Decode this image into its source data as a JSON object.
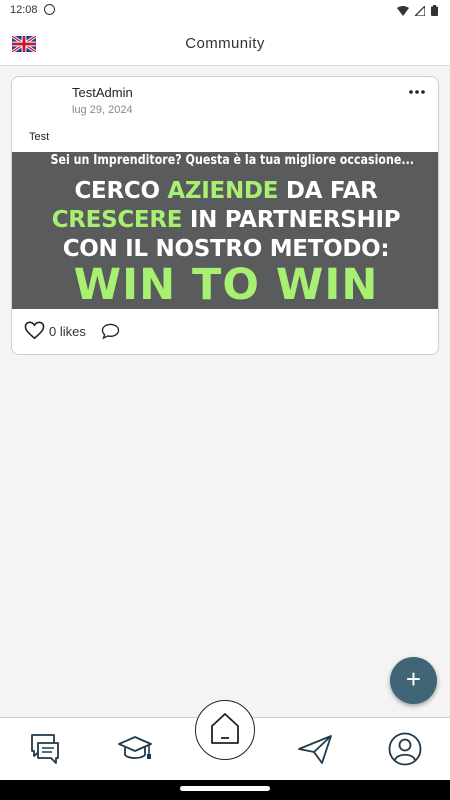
{
  "status_bar": {
    "time": "12:08",
    "icons": [
      "face-icon",
      "wifi-icon",
      "signal-icon",
      "battery-icon"
    ]
  },
  "header": {
    "title": "Community",
    "language_flag": "uk-flag-icon"
  },
  "post": {
    "author": "TestAdmin",
    "date": "lug 29, 2024",
    "text": "Test",
    "image": {
      "subtitle": "Sei un Imprenditore? Questa è la tua migliore occasione...",
      "line1": {
        "a": "CERCO ",
        "b": "AZIENDE",
        "c": " DA FAR"
      },
      "line2": {
        "a": "CRESCERE",
        "b": " IN PARTNERSHIP"
      },
      "line3": "CON IL NOSTRO METODO:",
      "headline": "WIN TO WIN",
      "background_color": "#5a5b5c",
      "accent_color": "#a8f072"
    },
    "likes": "0 likes"
  },
  "fab": {
    "label": "+",
    "color": "#3f6577"
  },
  "bottom_nav": {
    "items": [
      "chat-icon",
      "graduation-cap-icon",
      "home-icon",
      "send-icon",
      "profile-icon"
    ]
  }
}
